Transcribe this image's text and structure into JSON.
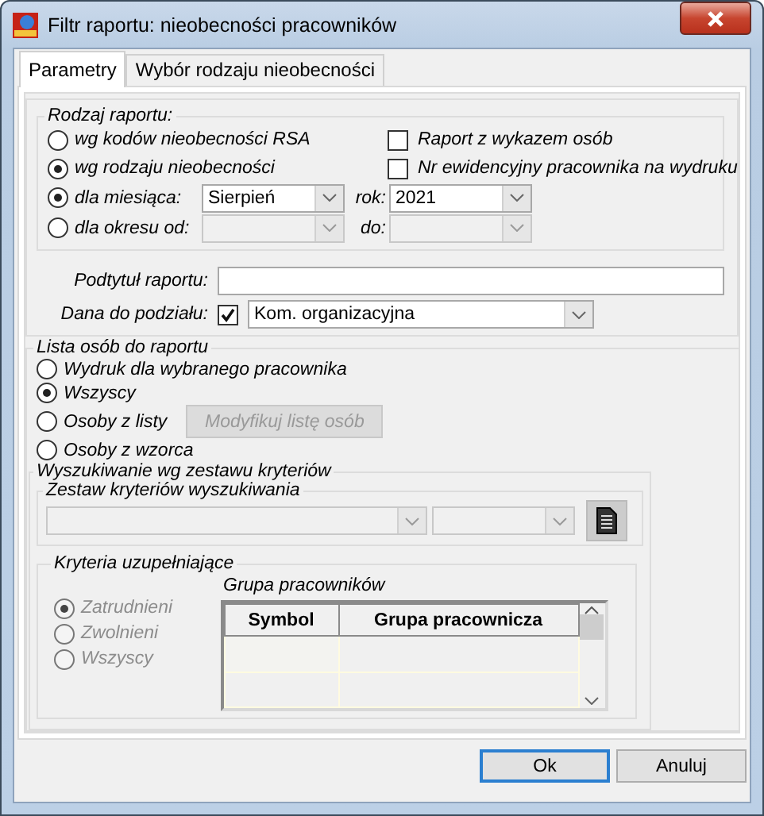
{
  "window": {
    "title": "Filtr raportu: nieobecności pracowników"
  },
  "tabs": [
    {
      "label": "Parametry",
      "selected": true
    },
    {
      "label": "Wybór rodzaju nieobecności",
      "selected": false
    }
  ],
  "report_type": {
    "legend": "Rodzaj raportu:",
    "basis_options": [
      {
        "label": "wg kodów nieobecności RSA",
        "selected": false
      },
      {
        "label": "wg rodzaju nieobecności",
        "selected": true
      }
    ],
    "checkboxes": [
      {
        "label": "Raport z wykazem osób",
        "checked": false
      },
      {
        "label": "Nr ewidencyjny pracownika na wydruku",
        "checked": false
      }
    ],
    "period_options": [
      {
        "label": "dla miesiąca:",
        "selected": true,
        "first": {
          "value": "Sierpień",
          "disabled": false
        },
        "second_label": "rok:",
        "second": {
          "value": "2021",
          "disabled": false
        }
      },
      {
        "label": "dla okresu od:",
        "selected": false,
        "first": {
          "disabled": true
        },
        "second_label": "do:",
        "second": {
          "disabled": true
        }
      }
    ]
  },
  "subtitle": {
    "label": "Podtytuł raportu:"
  },
  "split": {
    "label": "Dana do podziału:",
    "checked": true,
    "value": "Kom. organizacyjna"
  },
  "person_list": {
    "legend": "Lista osób do raportu",
    "options": [
      {
        "label": "Wydruk dla wybranego pracownika",
        "selected": false
      },
      {
        "label": "Wszyscy",
        "selected": true
      },
      {
        "label": "Osoby z listy",
        "selected": false,
        "button": {
          "label": "Modyfikuj listę osób",
          "disabled": true
        }
      },
      {
        "label": "Osoby z wzorca",
        "selected": false
      }
    ]
  },
  "search": {
    "legend": "Wyszukiwanie wg zestawu kryteriów",
    "set_legend": "Zestaw kryteriów wyszukiwania",
    "supplementary": {
      "legend": "Kryteria uzupełniające",
      "disabled": true,
      "options": [
        {
          "label": "Zatrudnieni",
          "selected": true
        },
        {
          "label": "Zwolnieni",
          "selected": false
        },
        {
          "label": "Wszyscy",
          "selected": false
        }
      ],
      "group_title": "Grupa pracowników",
      "columns": [
        "Symbol",
        "Grupa pracownicza"
      ]
    }
  },
  "buttons": [
    {
      "label": "Ok",
      "default": true
    },
    {
      "label": "Anuluj",
      "default": false
    }
  ]
}
